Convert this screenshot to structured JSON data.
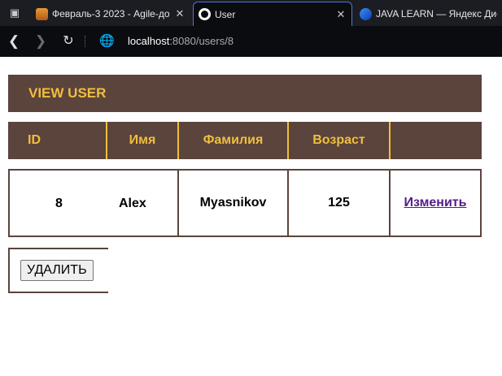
{
  "browser": {
    "tabs": [
      {
        "label": "Февраль-3 2023 - Agile-до",
        "icon": "orange-app-icon"
      },
      {
        "label": "User",
        "icon": "globe-icon",
        "active": true
      },
      {
        "label": "JAVA LEARN — Яндекс Дис",
        "icon": "yandex-disk-icon"
      }
    ],
    "address": {
      "host": "localhost",
      "path": ":8080/users/8"
    }
  },
  "page": {
    "title": "VIEW USER",
    "table": {
      "headers": [
        "ID",
        "Имя",
        "Фамилия",
        "Возраст",
        ""
      ],
      "row": {
        "id": "8",
        "name": "Alex",
        "surname": "Myasnikov",
        "age": "125",
        "edit_label": "Изменить"
      }
    },
    "delete_label": "УДАЛИТЬ"
  },
  "colors": {
    "header_bg": "#5a443c",
    "header_text": "#f1be3e",
    "link": "#551a8b"
  }
}
